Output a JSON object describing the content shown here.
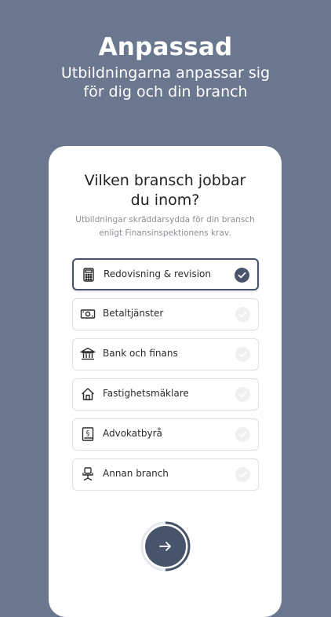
{
  "hero": {
    "title": "Anpassad",
    "subtitle_line1": "Utbildningarna anpassar sig",
    "subtitle_line2": "för dig och din branch"
  },
  "card": {
    "title_line1": "Vilken bransch jobbar",
    "title_line2": "du inom?",
    "subtitle_line1": "Utbildningar skräddarsydda för din bransch",
    "subtitle_line2": "enligt Finansinspektionens krav.",
    "options": [
      {
        "label": "Redovisning & revision",
        "icon": "calculator-icon",
        "selected": true
      },
      {
        "label": "Betaltjänster",
        "icon": "banknote-icon",
        "selected": false
      },
      {
        "label": "Bank och finans",
        "icon": "bank-icon",
        "selected": false
      },
      {
        "label": "Fastighetsmäklare",
        "icon": "house-icon",
        "selected": false
      },
      {
        "label": "Advokatbyrå",
        "icon": "law-book-icon",
        "selected": false
      },
      {
        "label": "Annan branch",
        "icon": "office-chair-icon",
        "selected": false
      }
    ],
    "next_icon": "arrow-right-icon"
  },
  "colors": {
    "background": "#6b778f",
    "accent": "#47546b",
    "card": "#ffffff"
  }
}
